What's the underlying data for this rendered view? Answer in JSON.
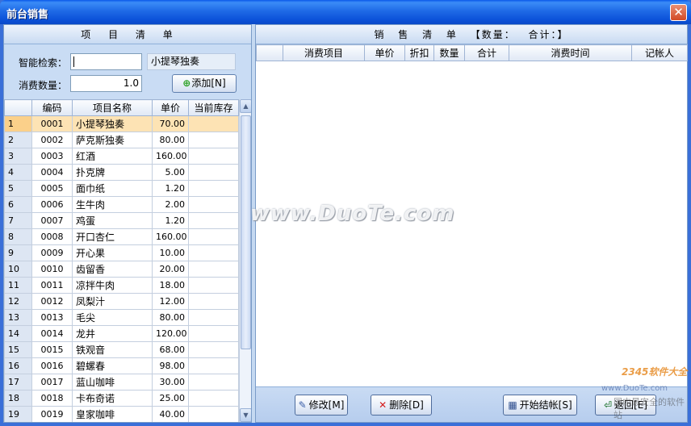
{
  "window": {
    "title": "前台销售",
    "close": "✕"
  },
  "left": {
    "header": "项  目  清  单",
    "search_label": "智能检索：",
    "search_value": "",
    "matched_item": "小提琴独奏",
    "qty_label": "消费数量：",
    "qty_value": "1.0",
    "add_button": "添加[N]",
    "columns": [
      "",
      "编码",
      "项目名称",
      "单价",
      "当前库存"
    ],
    "rows": [
      {
        "idx": "1",
        "code": "0001",
        "name": "小提琴独奏",
        "price": "70.00",
        "stock": ""
      },
      {
        "idx": "2",
        "code": "0002",
        "name": "萨克斯独奏",
        "price": "80.00",
        "stock": ""
      },
      {
        "idx": "3",
        "code": "0003",
        "name": "红酒",
        "price": "160.00",
        "stock": ""
      },
      {
        "idx": "4",
        "code": "0004",
        "name": "扑克牌",
        "price": "5.00",
        "stock": ""
      },
      {
        "idx": "5",
        "code": "0005",
        "name": "面巾纸",
        "price": "1.20",
        "stock": ""
      },
      {
        "idx": "6",
        "code": "0006",
        "name": "生牛肉",
        "price": "2.00",
        "stock": ""
      },
      {
        "idx": "7",
        "code": "0007",
        "name": "鸡蛋",
        "price": "1.20",
        "stock": ""
      },
      {
        "idx": "8",
        "code": "0008",
        "name": "开口杏仁",
        "price": "160.00",
        "stock": ""
      },
      {
        "idx": "9",
        "code": "0009",
        "name": "开心果",
        "price": "10.00",
        "stock": ""
      },
      {
        "idx": "10",
        "code": "0010",
        "name": "齿留香",
        "price": "20.00",
        "stock": ""
      },
      {
        "idx": "11",
        "code": "0011",
        "name": "凉拌牛肉",
        "price": "18.00",
        "stock": ""
      },
      {
        "idx": "12",
        "code": "0012",
        "name": "凤梨汁",
        "price": "12.00",
        "stock": ""
      },
      {
        "idx": "13",
        "code": "0013",
        "name": "毛尖",
        "price": "80.00",
        "stock": ""
      },
      {
        "idx": "14",
        "code": "0014",
        "name": "龙井",
        "price": "120.00",
        "stock": ""
      },
      {
        "idx": "15",
        "code": "0015",
        "name": "铁观音",
        "price": "68.00",
        "stock": ""
      },
      {
        "idx": "16",
        "code": "0016",
        "name": "碧螺春",
        "price": "98.00",
        "stock": ""
      },
      {
        "idx": "17",
        "code": "0017",
        "name": "蓝山咖啡",
        "price": "30.00",
        "stock": ""
      },
      {
        "idx": "18",
        "code": "0018",
        "name": "卡布奇诺",
        "price": "25.00",
        "stock": ""
      },
      {
        "idx": "19",
        "code": "0019",
        "name": "皇家咖啡",
        "price": "40.00",
        "stock": ""
      }
    ],
    "selected_index": 0
  },
  "right": {
    "header": "销  售  清  单  【数量：   合计：】",
    "columns": [
      "",
      "消费项目",
      "单价",
      "折扣",
      "数量",
      "合计",
      "消费时间",
      "记帐人"
    ],
    "buttons": {
      "edit": "修改[M]",
      "delete": "删除[D]",
      "checkout": "开始结帐[S]",
      "back": "返回[E]"
    }
  },
  "watermark": {
    "main": "www.DuoTe.com",
    "site": "www.DuoTe.com",
    "brand": "2345软件大全",
    "tail": "国内最安全的软件站"
  },
  "colors": {
    "titlebar": "#0c52d9",
    "panel_bg": "#c9dcf4",
    "selected_row": "#fde3b4"
  }
}
